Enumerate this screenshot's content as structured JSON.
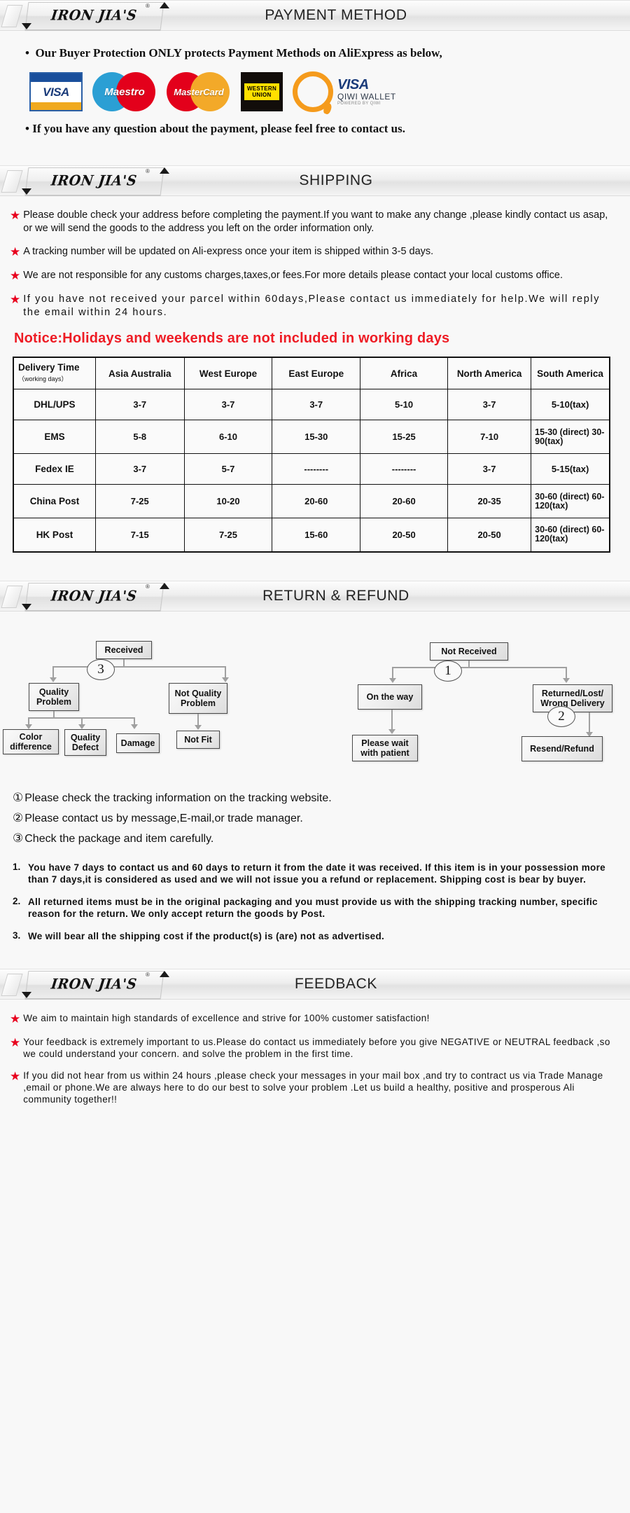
{
  "brand": {
    "name": "IRON JIA'S",
    "reg": "®"
  },
  "sections": {
    "payment": {
      "title": "PAYMENT METHOD",
      "bullet_top": "Our Buyer Protection ONLY protects Payment Methods on AliExpress as below,",
      "bullet_bottom": "If you have any question about the payment, please feel free to contact us.",
      "logos": [
        {
          "name": "visa-logo",
          "label": "VISA"
        },
        {
          "name": "maestro-logo",
          "label": "Maestro"
        },
        {
          "name": "mastercard-logo",
          "label": "MasterCard"
        },
        {
          "name": "western-union-logo",
          "line1": "WESTERN",
          "line2": "UNION"
        },
        {
          "name": "qiwi-wallet-logo",
          "line1": "VISA",
          "line2": "QIWI WALLET",
          "line3": "POWERED BY QIWI"
        }
      ]
    },
    "shipping": {
      "title": "SHIPPING",
      "points": [
        "Please double check your address before completing the payment.If you want to make any change ,please kindly contact us asap, or we will send the goods to the address you left on the order information only.",
        "A tracking number will be updated on Ali-express once your item is shipped within 3-5 days.",
        "We are not responsible for any customs charges,taxes,or fees.For more details please contact your local customs office.",
        "If you have not received your parcel within 60days,Please contact us immediately for help.We will reply the email within 24 hours."
      ],
      "notice": "Notice:Holidays and weekends are not included in working days",
      "table": {
        "corner_title": "Delivery Time",
        "corner_sub": "（working days）",
        "columns": [
          "Asia Australia",
          "West Europe",
          "East Europe",
          "Africa",
          "North America",
          "South America"
        ],
        "rows": [
          {
            "method": "DHL/UPS",
            "cells": [
              "3-7",
              "3-7",
              "3-7",
              "5-10",
              "3-7",
              "5-10(tax)"
            ]
          },
          {
            "method": "EMS",
            "cells": [
              "5-8",
              "6-10",
              "15-30",
              "15-25",
              "7-10",
              "15-30 (direct) 30-90(tax)"
            ]
          },
          {
            "method": "Fedex IE",
            "cells": [
              "3-7",
              "5-7",
              "--------",
              "--------",
              "3-7",
              "5-15(tax)"
            ]
          },
          {
            "method": "China Post",
            "cells": [
              "7-25",
              "10-20",
              "20-60",
              "20-60",
              "20-35",
              "30-60 (direct) 60-120(tax)"
            ]
          },
          {
            "method": "HK Post",
            "cells": [
              "7-15",
              "7-25",
              "15-60",
              "20-50",
              "20-50",
              "30-60 (direct) 60-120(tax)"
            ]
          }
        ]
      }
    },
    "return": {
      "title": "RETURN & REFUND",
      "flow": {
        "received": "Received",
        "quality_problem": "Quality Problem",
        "not_quality_problem": "Not Quality Problem",
        "color_difference": "Color difference",
        "quality_defect": "Quality Defect",
        "damage": "Damage",
        "not_fit": "Not Fit",
        "not_received": "Not  Received",
        "on_the_way": "On the way",
        "returned_lost": "Returned/Lost/ Wrong Delivery",
        "please_wait": "Please wait with patient",
        "resend_refund": "Resend/Refund",
        "marker1": "1",
        "marker2": "2",
        "marker3": "3"
      },
      "notes": [
        {
          "num": "①",
          "text": "Please check the tracking information on the tracking website."
        },
        {
          "num": "②",
          "text": "Please contact us by  message,E-mail,or trade manager."
        },
        {
          "num": "③",
          "text": "Check the package and item carefully."
        }
      ],
      "policy": [
        {
          "num": "1.",
          "text": "You have 7 days to contact us and 60 days to return it from the date it was received. If this item is in your possession more than 7 days,it is considered as used and we will not issue you a refund or replacement. Shipping cost is bear by buyer."
        },
        {
          "num": "2.",
          "text": "All returned items must be in the original packaging and you must provide us with the shipping tracking number, specific reason for the return. We only accept return the goods by Post."
        },
        {
          "num": "3.",
          "text": "We will bear all the shipping cost if the product(s) is (are) not as advertised."
        }
      ]
    },
    "feedback": {
      "title": "FEEDBACK",
      "points": [
        "We aim to maintain high standards of excellence and strive  for 100% customer satisfaction!",
        "Your feedback is extremely important to us.Please do contact us immediately before you give NEGATIVE or NEUTRAL feedback ,so  we could understand your concern. and solve the problem in the first time.",
        "If you did not hear from us within 24 hours ,please check your messages in your mail box ,and try to contract us via Trade Manage ,email or phone.We are always here to do our best to solve your problem .Let us build a healthy, positive and prosperous Ali community together!!"
      ]
    }
  },
  "colors": {
    "star": "#e8001d",
    "notice": "#ee1b24",
    "visa_blue": "#1a3b7a",
    "mc_red": "#e3001b",
    "mc_orange": "#f3a929"
  }
}
